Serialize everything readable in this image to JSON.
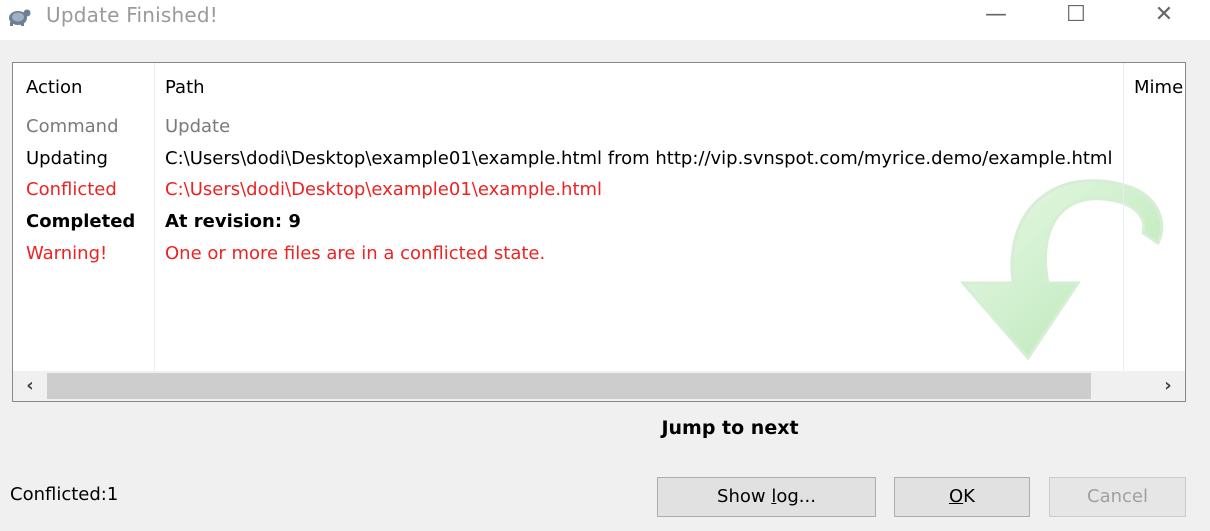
{
  "window": {
    "title": "Update Finished!",
    "minimize_glyph": "—",
    "maximize_glyph": "☐",
    "close_glyph": "✕"
  },
  "list": {
    "columns": [
      "Action",
      "Path",
      "Mime"
    ],
    "rows": [
      {
        "action": "Command",
        "path": "Update",
        "style": "gray"
      },
      {
        "action": "Updating",
        "path": "C:\\Users\\dodi\\Desktop\\example01\\example.html from http://vip.svnspot.com/myrice.demo/example.html",
        "style": "black"
      },
      {
        "action": "Conflicted",
        "path": "C:\\Users\\dodi\\Desktop\\example01\\example.html",
        "style": "red"
      },
      {
        "action": "Completed",
        "path": "At revision: 9",
        "style": "bold"
      },
      {
        "action": "Warning!",
        "path": "One or more files are in a conflicted state.",
        "style": "red"
      }
    ],
    "scroll_left": "‹",
    "scroll_right": "›"
  },
  "jump_label": "Jump to next",
  "status": {
    "label": "Conflicted:",
    "count": "1"
  },
  "buttons": {
    "showlog_pre": "Show ",
    "showlog_ul": "l",
    "showlog_post": "og...",
    "ok_ul": "O",
    "ok_post": "K",
    "cancel": "Cancel"
  },
  "colors": {
    "conflict_red": "#ee2222",
    "watermark_green": "#9be09b"
  }
}
